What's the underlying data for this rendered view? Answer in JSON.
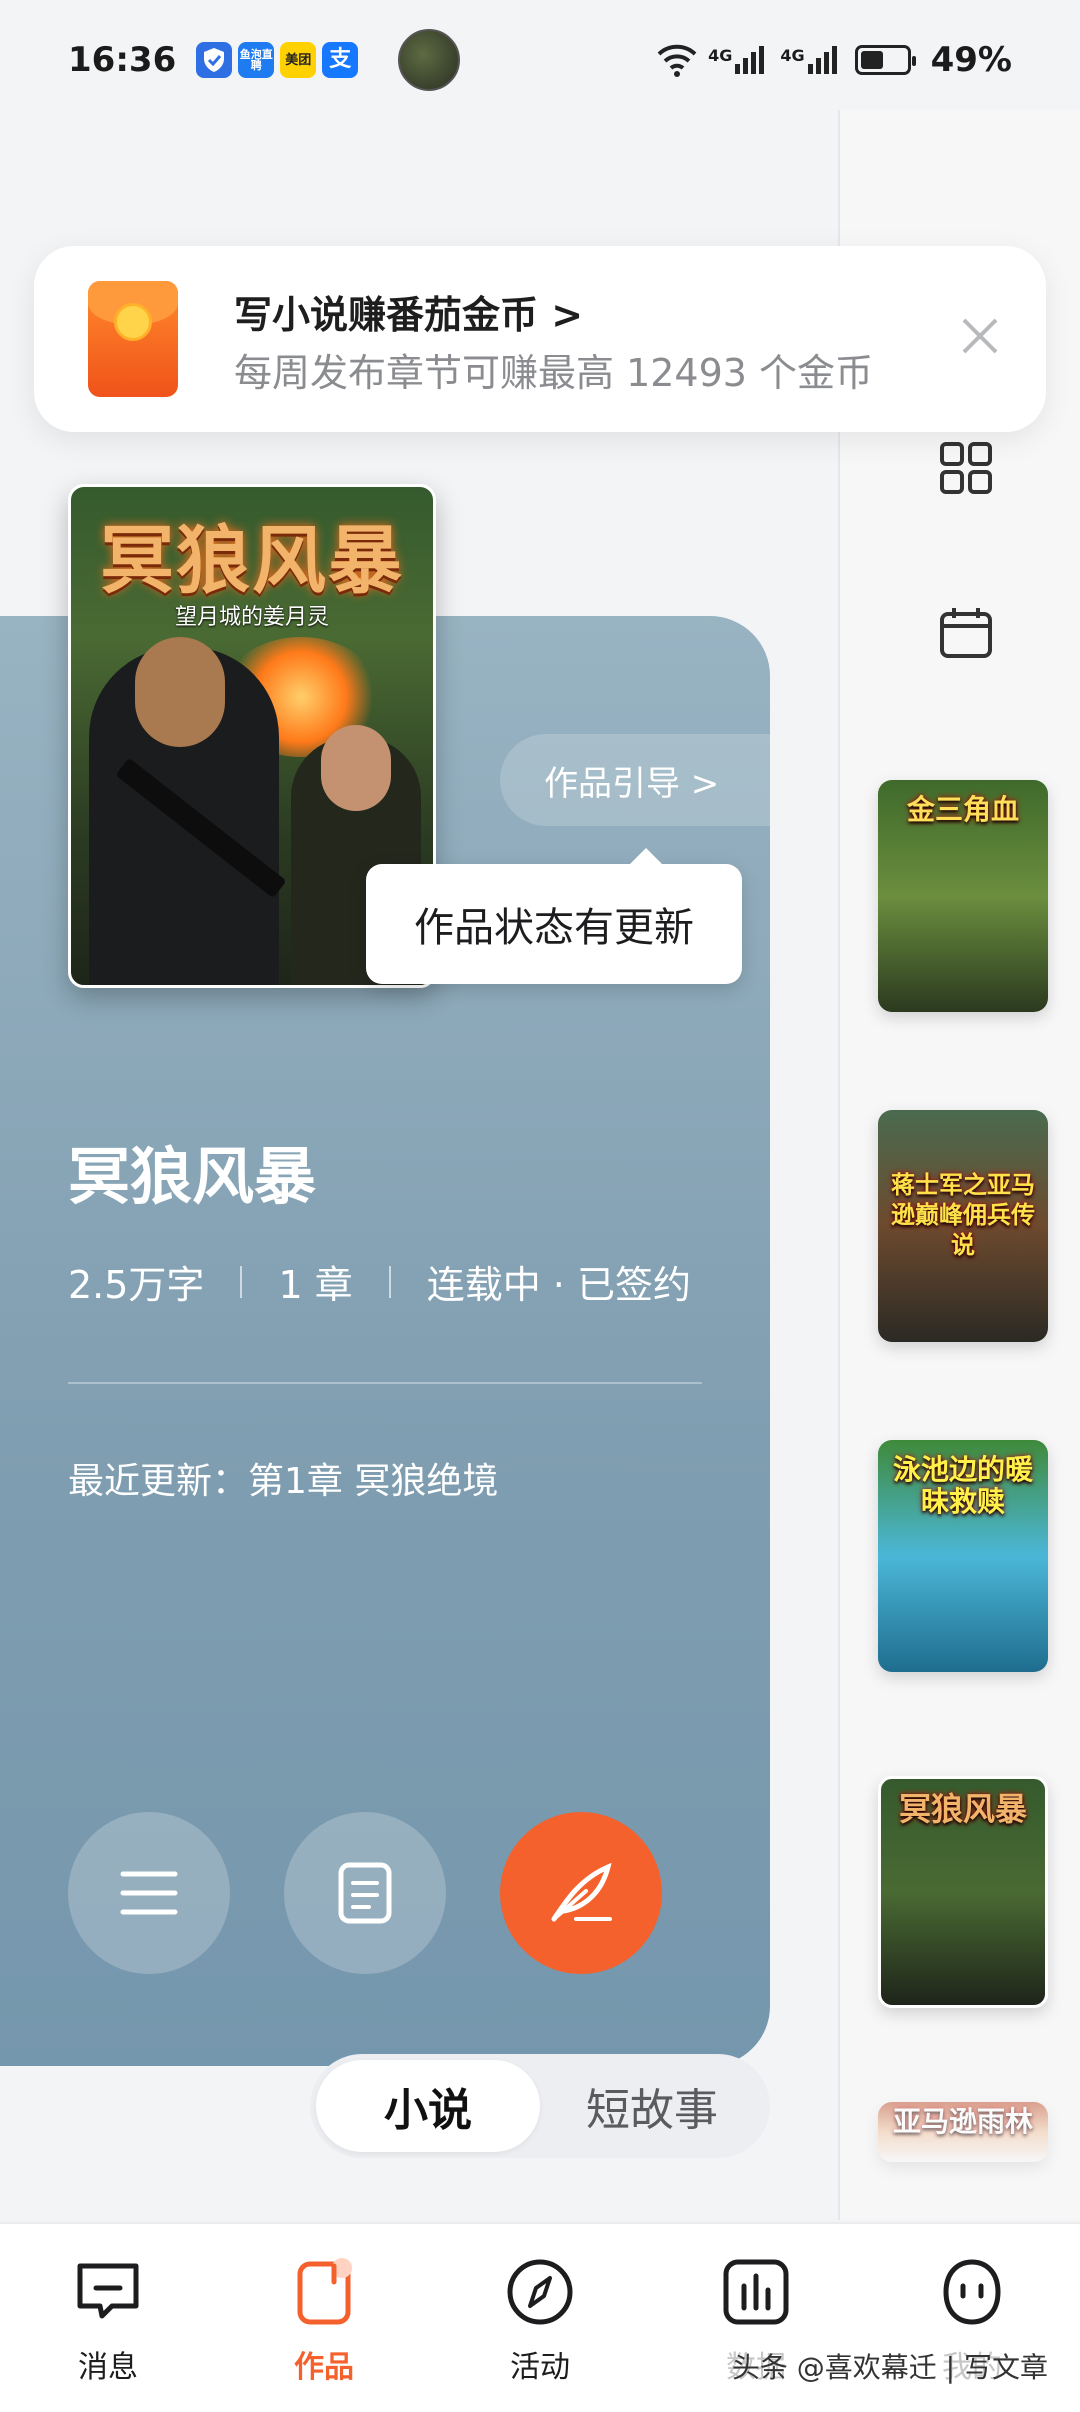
{
  "status_bar": {
    "time": "16:36",
    "app_badges": [
      {
        "name": "shield-app-icon",
        "text": "",
        "color": "#2f6fe4"
      },
      {
        "name": "yupao-app-icon",
        "text": "鱼泡直聘",
        "color": "#1e7cf0"
      },
      {
        "name": "meituan-app-icon",
        "text": "美团",
        "color": "#ffd100"
      },
      {
        "name": "alipay-app-icon",
        "text": "支",
        "color": "#1677ff"
      }
    ],
    "network_1": "4G",
    "network_2": "4G",
    "battery_level": 0.49,
    "battery_text": "49%"
  },
  "banner": {
    "title": "写小说赚番茄金币 >",
    "subtitle": "每周发布章节可赚最高 12493 个金币"
  },
  "work": {
    "cover_title": "冥狼风暴",
    "cover_author": "望月城的姜月灵",
    "guide_label": "作品引导 >",
    "tooltip": "作品状态有更新",
    "title": "冥狼风暴",
    "word_count": "2.5万字",
    "chapters": "1 章",
    "status": "连载中 · 已签约",
    "latest_update": "最近更新：第1章 冥狼绝境"
  },
  "side_list": {
    "thumbs": [
      {
        "title": "金三角血",
        "colors": [
          "#3f6a2b",
          "#6b8e3e",
          "#2b3a1f"
        ]
      },
      {
        "title": "蒋士军之亚马逊巅峰佣兵传说",
        "colors": [
          "#4a6b4f",
          "#6d4a2e",
          "#2b2a24"
        ]
      },
      {
        "title": "泳池边的暖昧救赎",
        "colors": [
          "#3f8a3a",
          "#4bb7d8",
          "#1f6d8e"
        ]
      },
      {
        "title": "冥狼风暴",
        "colors": [
          "#355a2d",
          "#4a6a33",
          "#1e251a"
        ]
      },
      {
        "title": "亚马逊雨林",
        "colors": [
          "#c25a3a",
          "#f1c9a8",
          "#f7f7f8"
        ]
      }
    ]
  },
  "segment": {
    "tabs": [
      "小说",
      "短故事"
    ]
  },
  "bottom_nav": [
    {
      "label": "消息",
      "icon": "message-icon"
    },
    {
      "label": "作品",
      "icon": "works-icon"
    },
    {
      "label": "活动",
      "icon": "compass-icon"
    },
    {
      "label": "数据",
      "icon": "bar-chart-icon"
    },
    {
      "label": "我的",
      "icon": "face-icon"
    }
  ],
  "watermark": "头条 @喜欢幕迁 | 写文章",
  "colors": {
    "accent": "#f4612d",
    "card": "#7f9db0"
  }
}
